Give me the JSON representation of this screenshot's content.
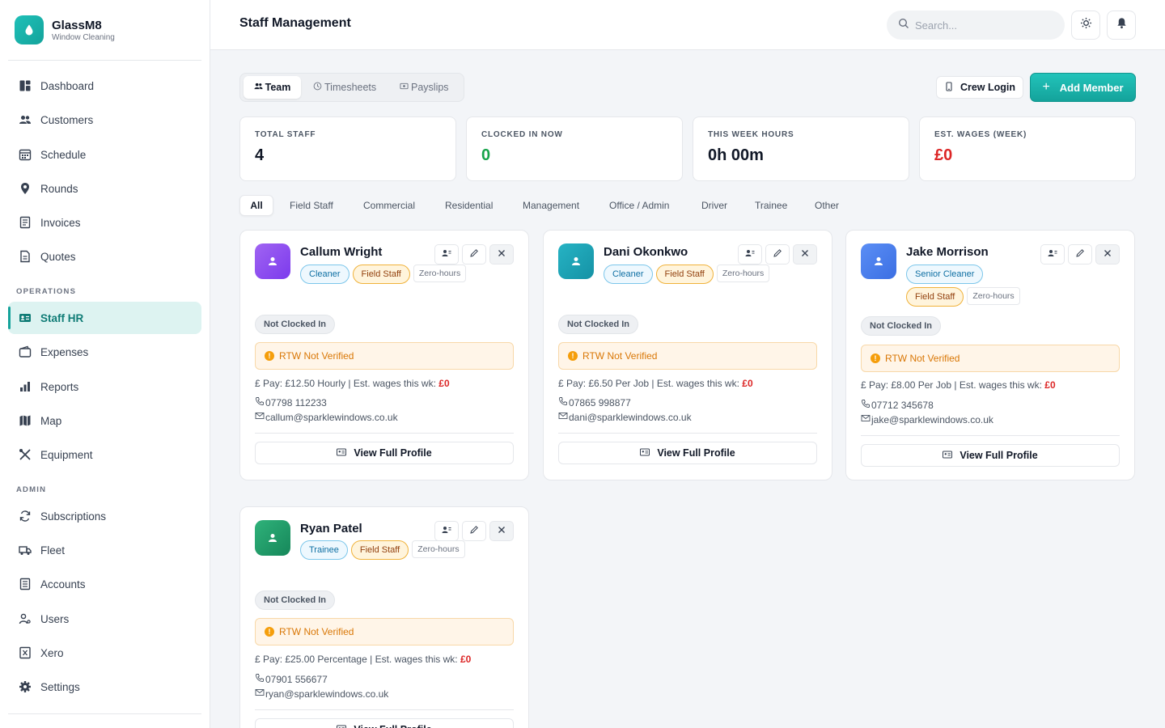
{
  "brand": {
    "name": "GlassM8",
    "subtitle": "Window Cleaning"
  },
  "sidebar": {
    "items": [
      {
        "label": "Dashboard",
        "icon": "dashboard-icon"
      },
      {
        "label": "Customers",
        "icon": "users-icon"
      },
      {
        "label": "Schedule",
        "icon": "calendar-icon"
      },
      {
        "label": "Rounds",
        "icon": "map-pin-icon"
      },
      {
        "label": "Invoices",
        "icon": "invoice-icon"
      },
      {
        "label": "Quotes",
        "icon": "file-icon"
      }
    ],
    "operations_label": "OPERATIONS",
    "operations": [
      {
        "label": "Staff HR",
        "icon": "id-card-icon",
        "active": true
      },
      {
        "label": "Expenses",
        "icon": "wallet-icon"
      },
      {
        "label": "Reports",
        "icon": "bar-chart-icon"
      },
      {
        "label": "Map",
        "icon": "map-icon"
      },
      {
        "label": "Equipment",
        "icon": "tools-icon"
      }
    ],
    "admin_label": "ADMIN",
    "admin": [
      {
        "label": "Subscriptions",
        "icon": "refresh-icon"
      },
      {
        "label": "Fleet",
        "icon": "truck-icon"
      },
      {
        "label": "Accounts",
        "icon": "ledger-icon"
      },
      {
        "label": "Users",
        "icon": "user-gear-icon"
      },
      {
        "label": "Xero",
        "icon": "xero-icon"
      },
      {
        "label": "Settings",
        "icon": "gear-icon"
      }
    ]
  },
  "header": {
    "title": "Staff Management",
    "search_placeholder": "Search..."
  },
  "tabs": [
    {
      "label": "Team",
      "icon": "team-icon",
      "active": true
    },
    {
      "label": "Timesheets",
      "icon": "clock-icon"
    },
    {
      "label": "Payslips",
      "icon": "payslip-icon"
    }
  ],
  "actions": {
    "crew_login": "Crew Login",
    "add_member": "Add Member"
  },
  "stats": [
    {
      "label": "TOTAL STAFF",
      "value": "4",
      "color": "#111827"
    },
    {
      "label": "CLOCKED IN NOW",
      "value": "0",
      "color": "#16a34a"
    },
    {
      "label": "THIS WEEK HOURS",
      "value": "0h 00m",
      "color": "#111827"
    },
    {
      "label": "EST. WAGES (WEEK)",
      "value": "£0",
      "color": "#dc2626"
    }
  ],
  "filters": [
    "All",
    "Field Staff",
    "Commercial",
    "Residential",
    "Management",
    "Office / Admin",
    "Driver",
    "Trainee",
    "Other"
  ],
  "staff_common": {
    "status": "Not Clocked In",
    "rtw": "RTW Not Verified",
    "wages_label": "Est. wages this wk:",
    "view_profile": "View Full Profile"
  },
  "staff": [
    {
      "name": "Callum Wright",
      "role": "Cleaner",
      "group": "Field Staff",
      "contract": "Zero-hours",
      "pay": "Pay: £12.50 Hourly",
      "wages": "£0",
      "phone": "07798 112233",
      "email": "callum@sparklewindows.co.uk",
      "avatar_color": "#8b5cf6"
    },
    {
      "name": "Dani Okonkwo",
      "role": "Cleaner",
      "group": "Field Staff",
      "contract": "Zero-hours",
      "pay": "Pay: £6.50 Per Job",
      "wages": "£0",
      "phone": "07865 998877",
      "email": "dani@sparklewindows.co.uk",
      "avatar_color": "#1ea6b8"
    },
    {
      "name": "Jake Morrison",
      "role": "Senior Cleaner",
      "group": "Field Staff",
      "contract": "Zero-hours",
      "pay": "Pay: £8.00 Per Job",
      "wages": "£0",
      "phone": "07712 345678",
      "email": "jake@sparklewindows.co.uk",
      "avatar_color": "#3b82f6"
    },
    {
      "name": "Ryan Patel",
      "role": "Trainee",
      "group": "Field Staff",
      "contract": "Zero-hours",
      "pay": "Pay: £25.00 Percentage",
      "wages": "£0",
      "phone": "07901 556677",
      "email": "ryan@sparklewindows.co.uk",
      "avatar_color": "#22a06b"
    }
  ],
  "colors": {
    "accent": "#14a39b",
    "wage_red": "#dc2626",
    "rtw_orange": "#d97706"
  }
}
